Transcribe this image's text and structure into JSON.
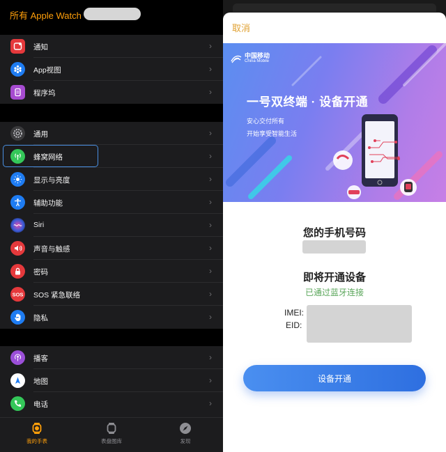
{
  "left": {
    "title": "所有 Apple Watch",
    "groups": [
      {
        "items": [
          {
            "label": "通知",
            "icon": "notification-icon",
            "color": "#e5393c"
          },
          {
            "label": "App视图",
            "icon": "app-grid-icon",
            "color": "#1e7cf2"
          },
          {
            "label": "程序坞",
            "icon": "dock-icon",
            "color": "#a64bd0"
          }
        ]
      },
      {
        "items": [
          {
            "label": "通用",
            "icon": "gear-icon",
            "color": "#8e8e93"
          },
          {
            "label": "蜂窝网络",
            "icon": "cellular-icon",
            "color": "#34c759"
          },
          {
            "label": "显示与亮度",
            "icon": "brightness-icon",
            "color": "#1e7cf2"
          },
          {
            "label": "辅助功能",
            "icon": "accessibility-icon",
            "color": "#1e7cf2"
          },
          {
            "label": "Siri",
            "icon": "siri-icon",
            "color": "#2b2b7a"
          },
          {
            "label": "声音与触感",
            "icon": "sound-icon",
            "color": "#e5393c"
          },
          {
            "label": "密码",
            "icon": "lock-icon",
            "color": "#e5393c"
          },
          {
            "label": "SOS 紧急联络",
            "icon": "sos-icon",
            "color": "#e5393c"
          },
          {
            "label": "隐私",
            "icon": "hand-icon",
            "color": "#1e7cf2"
          }
        ]
      },
      {
        "items": [
          {
            "label": "播客",
            "icon": "podcast-icon",
            "color": "#9b4fd8"
          },
          {
            "label": "地图",
            "icon": "maps-icon",
            "color": "#ffffff"
          },
          {
            "label": "电话",
            "icon": "phone-icon",
            "color": "#34c759"
          }
        ]
      }
    ],
    "tabs": [
      {
        "label": "我的手表",
        "icon": "watch-icon",
        "active": true
      },
      {
        "label": "表盘图库",
        "icon": "watchface-icon",
        "active": false
      },
      {
        "label": "发现",
        "icon": "compass-icon",
        "active": false
      }
    ]
  },
  "right": {
    "cancel": "取消",
    "banner": {
      "brand": "中国移动",
      "brand_en": "China Mobile",
      "title": "一号双终端 · 设备开通",
      "sub1": "安心交付所有",
      "sub2": "开始享受智能生活"
    },
    "phone_title": "您的手机号码",
    "device_title": "即将开通设备",
    "bt_status": "已通过蓝牙连接",
    "imei_label": "IMEI:",
    "eid_label": "EID:",
    "activate_button": "设备开通"
  },
  "colors": {
    "accent_orange": "#ff9f0a",
    "button_blue": "#3b7fe8",
    "success_green": "#5aa65a"
  }
}
